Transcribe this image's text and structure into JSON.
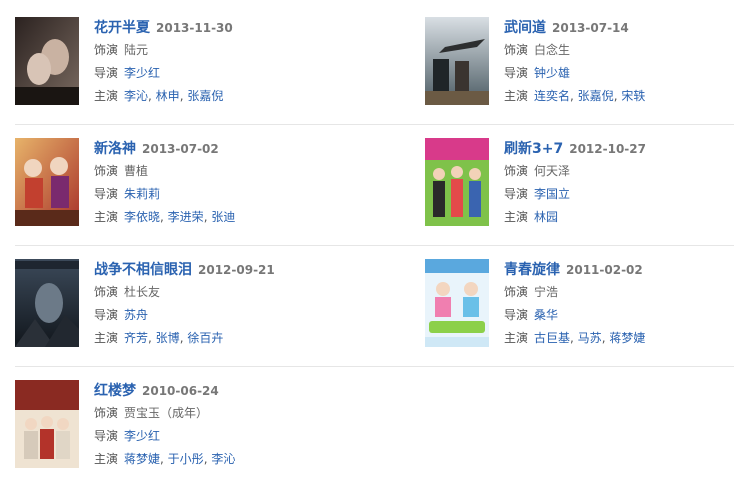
{
  "labels": {
    "role": "饰演",
    "director": "导演",
    "cast": "主演"
  },
  "films": [
    {
      "title": "花开半夏",
      "date": "2013-11-30",
      "role": "陆元",
      "director": "李少红",
      "cast": [
        "李沁",
        "林申",
        "张嘉倪"
      ]
    },
    {
      "title": "武间道",
      "date": "2013-07-14",
      "role": "白念生",
      "director": "钟少雄",
      "cast": [
        "连奕名",
        "张嘉倪",
        "宋轶"
      ]
    },
    {
      "title": "新洛神",
      "date": "2013-07-02",
      "role": "曹植",
      "director": "朱莉莉",
      "cast": [
        "李依晓",
        "李进荣",
        "张迪"
      ]
    },
    {
      "title": "刷新3+7",
      "date": "2012-10-27",
      "role": "何天泽",
      "director": "李国立",
      "cast": [
        "林园"
      ]
    },
    {
      "title": "战争不相信眼泪",
      "date": "2012-09-21",
      "role": "杜长友",
      "director": "苏舟",
      "cast": [
        "齐芳",
        "张博",
        "徐百卉"
      ]
    },
    {
      "title": "青春旋律",
      "date": "2011-02-02",
      "role": "宁浩",
      "director": "桑华",
      "cast": [
        "古巨基",
        "马苏",
        "蒋梦婕"
      ]
    },
    {
      "title": "红楼梦",
      "date": "2010-06-24",
      "role": "贾宝玉（成年）",
      "director": "李少红",
      "cast": [
        "蒋梦婕",
        "于小彤",
        "李沁"
      ]
    }
  ]
}
